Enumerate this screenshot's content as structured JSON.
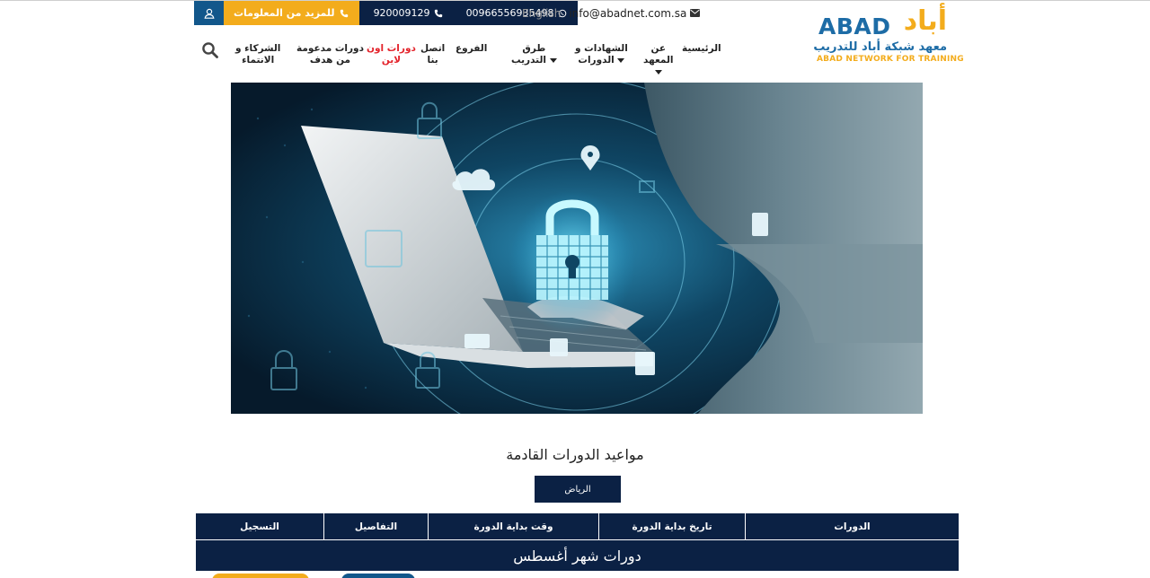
{
  "topbar": {
    "more_info": "للمزيد من المعلومات",
    "phone1": "920009129",
    "phone2": "00966556935498",
    "language": "English",
    "email": "info@abadnet.com.sa"
  },
  "logo": {
    "latin": "ABAD",
    "arabic": "أباد",
    "subtitle_ar": "معهد شبكة أباد للتدريب",
    "subtitle_en": "ABAD NETWORK FOR TRAINING"
  },
  "nav": {
    "home": "الرئيسية",
    "about_l1": "عن",
    "about_l2": "المعهد",
    "certs_l1": "الشهادات و",
    "certs_l2": "الدورات",
    "methods_l1": "طرق",
    "methods_l2": "التدريب",
    "branches": "الفروع",
    "contact_l1": "اتصل",
    "contact_l2": "بنا",
    "online_l1": "دورات اون",
    "online_l2": "لاين",
    "hadaf_l1": "دورات مدعومة",
    "hadaf_l2": "من هدف",
    "partners_l1": "الشركاء و",
    "partners_l2": "الانتماء"
  },
  "schedule": {
    "title": "مواعيد الدورات القادمة",
    "city": "الرياض",
    "columns": [
      "التسجيل",
      "التفاصيل",
      "وقت بداية الدورة",
      "تاريخ بداية الدورة",
      "الدورات"
    ],
    "month": "دورات شهر أغسطس"
  },
  "colors": {
    "navy": "#0b2144",
    "accent_yellow": "#f3ac1c",
    "accent_blue": "#12578b",
    "online_red": "#e3222a"
  }
}
